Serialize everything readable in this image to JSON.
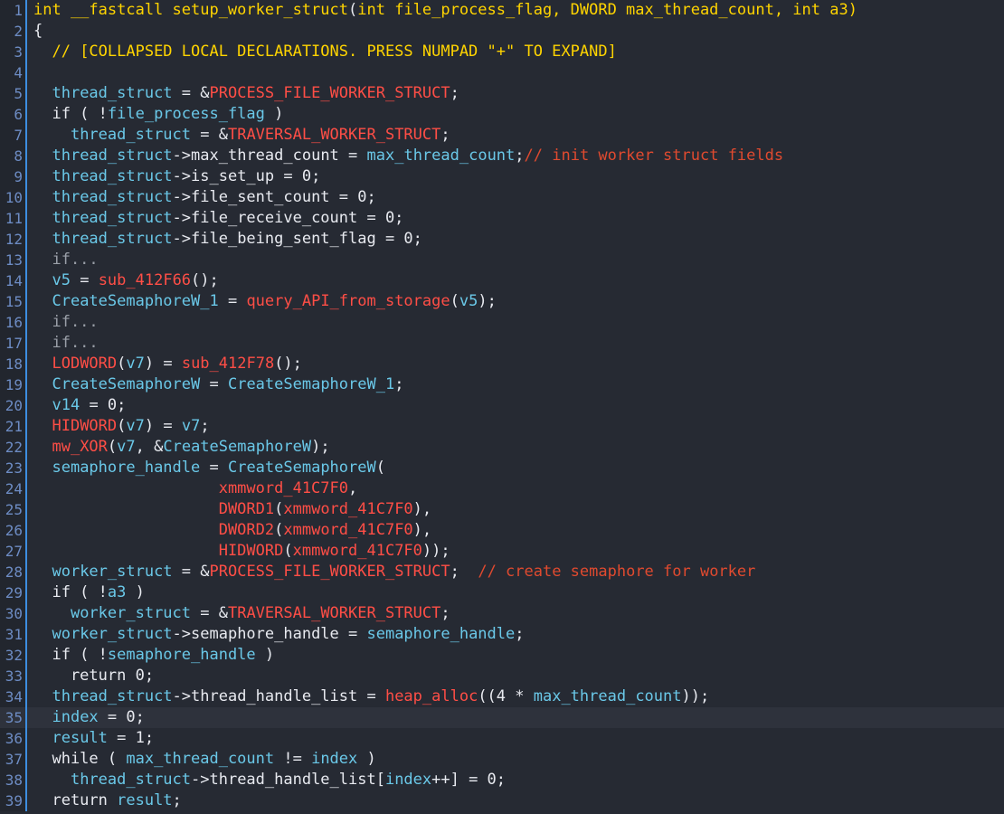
{
  "editor": {
    "name": "ida-pseudocode-view",
    "background": "#262a33",
    "gutter_background": "#22262e",
    "gutter_separator_color": "#3d8ee0",
    "line_number_color": "#6d8cc4",
    "highlighted_line": 35,
    "highlight_color": "#2e323c",
    "palette": {
      "keyword_yellow": "#ffd400",
      "punctuation": "#e8eaf0",
      "local_variable": "#6ac8e8",
      "global_or_function": "#ff4e46",
      "comment": "#e04a2f",
      "collapsed_text": "#9a9fa8"
    },
    "function_signature": "int __fastcall setup_worker_struct(int file_process_flag, DWORD max_thread_count, int a3)"
  },
  "lines": [
    {
      "n": "1",
      "tokens": [
        {
          "t": "int __fastcall setup_worker_struct",
          "c": "kw"
        },
        {
          "t": "(",
          "c": "punc"
        },
        {
          "t": "int file_process_flag, DWORD max_thread_count, int a3",
          "c": "kw"
        },
        {
          "t": ")",
          "c": "kw"
        }
      ]
    },
    {
      "n": "2",
      "tokens": [
        {
          "t": "{",
          "c": "punc"
        }
      ]
    },
    {
      "n": "3",
      "tokens": [
        {
          "t": "  ",
          "c": "punc"
        },
        {
          "t": "// [COLLAPSED LOCAL DECLARATIONS. PRESS NUMPAD \"+\" TO EXPAND]",
          "c": "cmty"
        }
      ]
    },
    {
      "n": "4",
      "tokens": []
    },
    {
      "n": "5",
      "tokens": [
        {
          "t": "  ",
          "c": "punc"
        },
        {
          "t": "thread_struct",
          "c": "var"
        },
        {
          "t": " = &",
          "c": "punc"
        },
        {
          "t": "PROCESS_FILE_WORKER_STRUCT",
          "c": "glob"
        },
        {
          "t": ";",
          "c": "punc"
        }
      ]
    },
    {
      "n": "6",
      "tokens": [
        {
          "t": "  if ( !",
          "c": "punc"
        },
        {
          "t": "file_process_flag",
          "c": "var"
        },
        {
          "t": " )",
          "c": "punc"
        }
      ]
    },
    {
      "n": "7",
      "tokens": [
        {
          "t": "    ",
          "c": "punc"
        },
        {
          "t": "thread_struct",
          "c": "var"
        },
        {
          "t": " = &",
          "c": "punc"
        },
        {
          "t": "TRAVERSAL_WORKER_STRUCT",
          "c": "glob"
        },
        {
          "t": ";",
          "c": "punc"
        }
      ]
    },
    {
      "n": "8",
      "tokens": [
        {
          "t": "  ",
          "c": "punc"
        },
        {
          "t": "thread_struct",
          "c": "var"
        },
        {
          "t": "->",
          "c": "punc"
        },
        {
          "t": "max_thread_count",
          "c": "punc"
        },
        {
          "t": " = ",
          "c": "punc"
        },
        {
          "t": "max_thread_count",
          "c": "var"
        },
        {
          "t": ";",
          "c": "punc"
        },
        {
          "t": "// init worker struct fields",
          "c": "cmt"
        }
      ]
    },
    {
      "n": "9",
      "tokens": [
        {
          "t": "  ",
          "c": "punc"
        },
        {
          "t": "thread_struct",
          "c": "var"
        },
        {
          "t": "->is_set_up = 0;",
          "c": "punc"
        }
      ]
    },
    {
      "n": "10",
      "tokens": [
        {
          "t": "  ",
          "c": "punc"
        },
        {
          "t": "thread_struct",
          "c": "var"
        },
        {
          "t": "->file_sent_count = 0;",
          "c": "punc"
        }
      ]
    },
    {
      "n": "11",
      "tokens": [
        {
          "t": "  ",
          "c": "punc"
        },
        {
          "t": "thread_struct",
          "c": "var"
        },
        {
          "t": "->file_receive_count = 0;",
          "c": "punc"
        }
      ]
    },
    {
      "n": "12",
      "tokens": [
        {
          "t": "  ",
          "c": "punc"
        },
        {
          "t": "thread_struct",
          "c": "var"
        },
        {
          "t": "->file_being_sent_flag = 0;",
          "c": "punc"
        }
      ]
    },
    {
      "n": "13",
      "tokens": [
        {
          "t": "  if...",
          "c": "coll"
        }
      ]
    },
    {
      "n": "14",
      "tokens": [
        {
          "t": "  ",
          "c": "punc"
        },
        {
          "t": "v5",
          "c": "var"
        },
        {
          "t": " = ",
          "c": "punc"
        },
        {
          "t": "sub_412F66",
          "c": "glob"
        },
        {
          "t": "();",
          "c": "punc"
        }
      ]
    },
    {
      "n": "15",
      "tokens": [
        {
          "t": "  ",
          "c": "punc"
        },
        {
          "t": "CreateSemaphoreW_1",
          "c": "var"
        },
        {
          "t": " = ",
          "c": "punc"
        },
        {
          "t": "query_API_from_storage",
          "c": "glob"
        },
        {
          "t": "(",
          "c": "punc"
        },
        {
          "t": "v5",
          "c": "var"
        },
        {
          "t": ");",
          "c": "punc"
        }
      ]
    },
    {
      "n": "16",
      "tokens": [
        {
          "t": "  if...",
          "c": "coll"
        }
      ]
    },
    {
      "n": "17",
      "tokens": [
        {
          "t": "  if...",
          "c": "coll"
        }
      ]
    },
    {
      "n": "18",
      "tokens": [
        {
          "t": "  ",
          "c": "punc"
        },
        {
          "t": "LODWORD",
          "c": "glob"
        },
        {
          "t": "(",
          "c": "punc"
        },
        {
          "t": "v7",
          "c": "var"
        },
        {
          "t": ") = ",
          "c": "punc"
        },
        {
          "t": "sub_412F78",
          "c": "glob"
        },
        {
          "t": "();",
          "c": "punc"
        }
      ]
    },
    {
      "n": "19",
      "tokens": [
        {
          "t": "  ",
          "c": "punc"
        },
        {
          "t": "CreateSemaphoreW",
          "c": "var"
        },
        {
          "t": " = ",
          "c": "punc"
        },
        {
          "t": "CreateSemaphoreW_1",
          "c": "var"
        },
        {
          "t": ";",
          "c": "punc"
        }
      ]
    },
    {
      "n": "20",
      "tokens": [
        {
          "t": "  ",
          "c": "punc"
        },
        {
          "t": "v14",
          "c": "var"
        },
        {
          "t": " = 0;",
          "c": "punc"
        }
      ]
    },
    {
      "n": "21",
      "tokens": [
        {
          "t": "  ",
          "c": "punc"
        },
        {
          "t": "HIDWORD",
          "c": "glob"
        },
        {
          "t": "(",
          "c": "punc"
        },
        {
          "t": "v7",
          "c": "var"
        },
        {
          "t": ") = ",
          "c": "punc"
        },
        {
          "t": "v7",
          "c": "var"
        },
        {
          "t": ";",
          "c": "punc"
        }
      ]
    },
    {
      "n": "22",
      "tokens": [
        {
          "t": "  ",
          "c": "punc"
        },
        {
          "t": "mw_XOR",
          "c": "glob"
        },
        {
          "t": "(",
          "c": "punc"
        },
        {
          "t": "v7",
          "c": "var"
        },
        {
          "t": ", &",
          "c": "punc"
        },
        {
          "t": "CreateSemaphoreW",
          "c": "var"
        },
        {
          "t": ");",
          "c": "punc"
        }
      ]
    },
    {
      "n": "23",
      "tokens": [
        {
          "t": "  ",
          "c": "punc"
        },
        {
          "t": "semaphore_handle",
          "c": "var"
        },
        {
          "t": " = ",
          "c": "punc"
        },
        {
          "t": "CreateSemaphoreW",
          "c": "var"
        },
        {
          "t": "(",
          "c": "punc"
        }
      ]
    },
    {
      "n": "24",
      "tokens": [
        {
          "t": "                    ",
          "c": "punc"
        },
        {
          "t": "xmmword_41C7F0",
          "c": "glob"
        },
        {
          "t": ",",
          "c": "punc"
        }
      ]
    },
    {
      "n": "25",
      "tokens": [
        {
          "t": "                    ",
          "c": "punc"
        },
        {
          "t": "DWORD1",
          "c": "glob"
        },
        {
          "t": "(",
          "c": "punc"
        },
        {
          "t": "xmmword_41C7F0",
          "c": "glob"
        },
        {
          "t": "),",
          "c": "punc"
        }
      ]
    },
    {
      "n": "26",
      "tokens": [
        {
          "t": "                    ",
          "c": "punc"
        },
        {
          "t": "DWORD2",
          "c": "glob"
        },
        {
          "t": "(",
          "c": "punc"
        },
        {
          "t": "xmmword_41C7F0",
          "c": "glob"
        },
        {
          "t": "),",
          "c": "punc"
        }
      ]
    },
    {
      "n": "27",
      "tokens": [
        {
          "t": "                    ",
          "c": "punc"
        },
        {
          "t": "HIDWORD",
          "c": "glob"
        },
        {
          "t": "(",
          "c": "punc"
        },
        {
          "t": "xmmword_41C7F0",
          "c": "glob"
        },
        {
          "t": "));",
          "c": "punc"
        }
      ]
    },
    {
      "n": "28",
      "tokens": [
        {
          "t": "  ",
          "c": "punc"
        },
        {
          "t": "worker_struct",
          "c": "var"
        },
        {
          "t": " = &",
          "c": "punc"
        },
        {
          "t": "PROCESS_FILE_WORKER_STRUCT",
          "c": "glob"
        },
        {
          "t": ";  ",
          "c": "punc"
        },
        {
          "t": "// create semaphore for worker",
          "c": "cmt"
        }
      ]
    },
    {
      "n": "29",
      "tokens": [
        {
          "t": "  if ( !",
          "c": "punc"
        },
        {
          "t": "a3",
          "c": "var"
        },
        {
          "t": " )",
          "c": "punc"
        }
      ]
    },
    {
      "n": "30",
      "tokens": [
        {
          "t": "    ",
          "c": "punc"
        },
        {
          "t": "worker_struct",
          "c": "var"
        },
        {
          "t": " = &",
          "c": "punc"
        },
        {
          "t": "TRAVERSAL_WORKER_STRUCT",
          "c": "glob"
        },
        {
          "t": ";",
          "c": "punc"
        }
      ]
    },
    {
      "n": "31",
      "tokens": [
        {
          "t": "  ",
          "c": "punc"
        },
        {
          "t": "worker_struct",
          "c": "var"
        },
        {
          "t": "->semaphore_handle = ",
          "c": "punc"
        },
        {
          "t": "semaphore_handle",
          "c": "var"
        },
        {
          "t": ";",
          "c": "punc"
        }
      ]
    },
    {
      "n": "32",
      "tokens": [
        {
          "t": "  if ( !",
          "c": "punc"
        },
        {
          "t": "semaphore_handle",
          "c": "var"
        },
        {
          "t": " )",
          "c": "punc"
        }
      ]
    },
    {
      "n": "33",
      "tokens": [
        {
          "t": "    return 0;",
          "c": "punc"
        }
      ]
    },
    {
      "n": "34",
      "tokens": [
        {
          "t": "  ",
          "c": "punc"
        },
        {
          "t": "thread_struct",
          "c": "var"
        },
        {
          "t": "->thread_handle_list = ",
          "c": "punc"
        },
        {
          "t": "heap_alloc",
          "c": "glob"
        },
        {
          "t": "((4 * ",
          "c": "punc"
        },
        {
          "t": "max_thread_count",
          "c": "var"
        },
        {
          "t": "));",
          "c": "punc"
        }
      ]
    },
    {
      "n": "35",
      "hl": true,
      "tokens": [
        {
          "t": "  ",
          "c": "punc"
        },
        {
          "t": "index",
          "c": "var"
        },
        {
          "t": " = 0;",
          "c": "punc"
        }
      ]
    },
    {
      "n": "36",
      "tokens": [
        {
          "t": "  ",
          "c": "punc"
        },
        {
          "t": "result",
          "c": "var"
        },
        {
          "t": " = 1;",
          "c": "punc"
        }
      ]
    },
    {
      "n": "37",
      "tokens": [
        {
          "t": "  while ( ",
          "c": "punc"
        },
        {
          "t": "max_thread_count",
          "c": "var"
        },
        {
          "t": " != ",
          "c": "punc"
        },
        {
          "t": "index",
          "c": "var"
        },
        {
          "t": " )",
          "c": "punc"
        }
      ]
    },
    {
      "n": "38",
      "tokens": [
        {
          "t": "    ",
          "c": "punc"
        },
        {
          "t": "thread_struct",
          "c": "var"
        },
        {
          "t": "->thread_handle_list[",
          "c": "punc"
        },
        {
          "t": "index",
          "c": "var"
        },
        {
          "t": "++] = 0;",
          "c": "punc"
        }
      ]
    },
    {
      "n": "39",
      "tokens": [
        {
          "t": "  return ",
          "c": "punc"
        },
        {
          "t": "result",
          "c": "var"
        },
        {
          "t": ";",
          "c": "punc"
        }
      ]
    }
  ]
}
